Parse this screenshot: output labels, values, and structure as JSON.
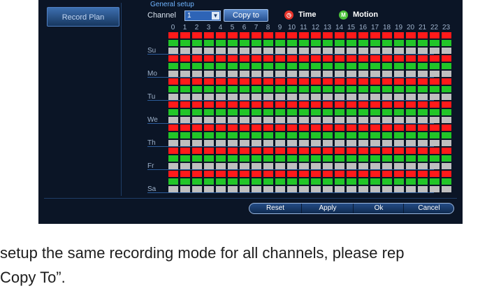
{
  "sidebar": {
    "tab_label": "Record Plan"
  },
  "header": {
    "section_title": "General setup",
    "channel_label": "Channel",
    "channel_value": "1",
    "copy_to_label": "Copy to",
    "legend": [
      {
        "symbol": "◷",
        "label": "Time",
        "color": "#e8342b"
      },
      {
        "symbol": "M",
        "label": "Motion",
        "color": "#4cc23a"
      }
    ]
  },
  "hours": [
    "0",
    "1",
    "2",
    "3",
    "4",
    "5",
    "6",
    "7",
    "8",
    "9",
    "10",
    "11",
    "12",
    "13",
    "14",
    "15",
    "16",
    "17",
    "18",
    "19",
    "20",
    "21",
    "22",
    "23"
  ],
  "days": [
    "Su",
    "Mo",
    "Tu",
    "We",
    "Th",
    "Fr",
    "Sa"
  ],
  "row_pattern": [
    "time",
    "motion",
    "none"
  ],
  "colors": {
    "time": "#ff1a1a",
    "motion": "#22c528",
    "none": "#bfbfbf"
  },
  "footer": {
    "buttons": [
      "Reset",
      "Apply",
      "Ok",
      "Cancel"
    ]
  },
  "caption": {
    "line1": "setup the same recording mode for all channels, please rep",
    "line2": "Copy To”."
  }
}
